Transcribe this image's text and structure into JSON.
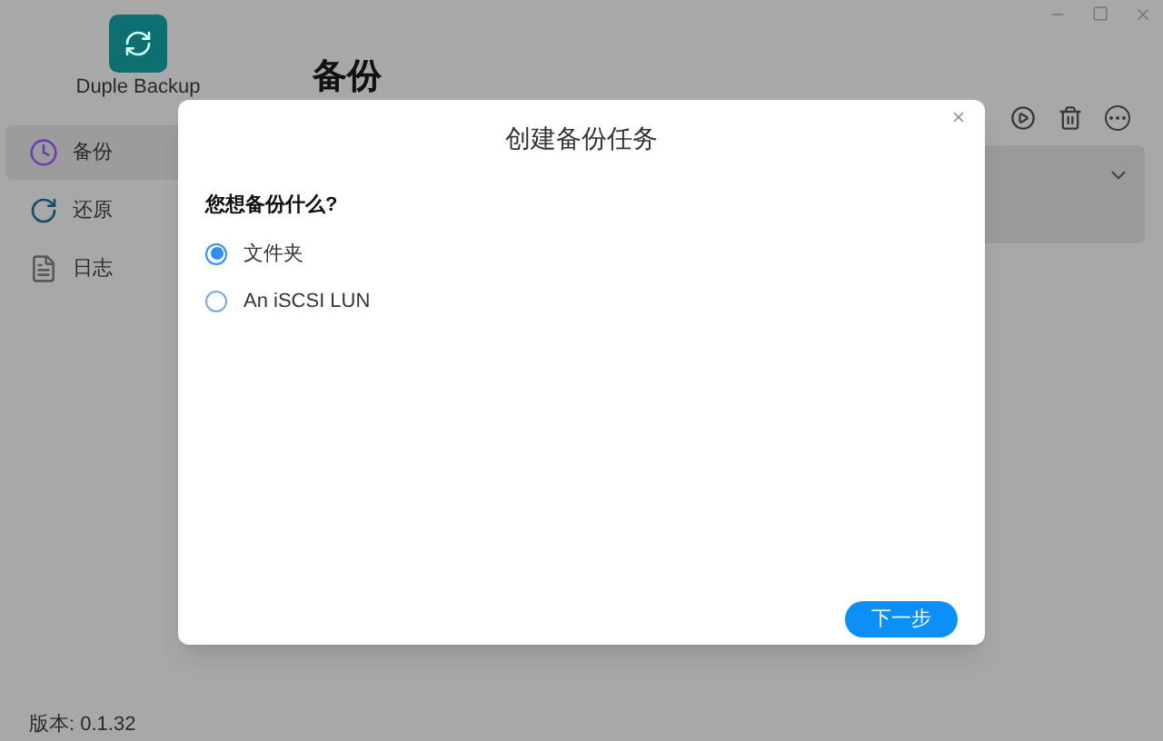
{
  "app": {
    "name": "Duple Backup",
    "version": "版本: 0.1.32"
  },
  "sidebar": {
    "items": [
      {
        "label": "备份",
        "kind": "backup",
        "selected": true
      },
      {
        "label": "还原",
        "kind": "restore",
        "selected": false
      },
      {
        "label": "日志",
        "kind": "log",
        "selected": false
      }
    ]
  },
  "page": {
    "title": "备份"
  },
  "dialog": {
    "title": "创建备份任务",
    "question": "您想备份什么?",
    "options": [
      {
        "label": "文件夹",
        "selected": true
      },
      {
        "label": "An iSCSI LUN",
        "selected": false
      }
    ],
    "next_button": "下一步"
  }
}
